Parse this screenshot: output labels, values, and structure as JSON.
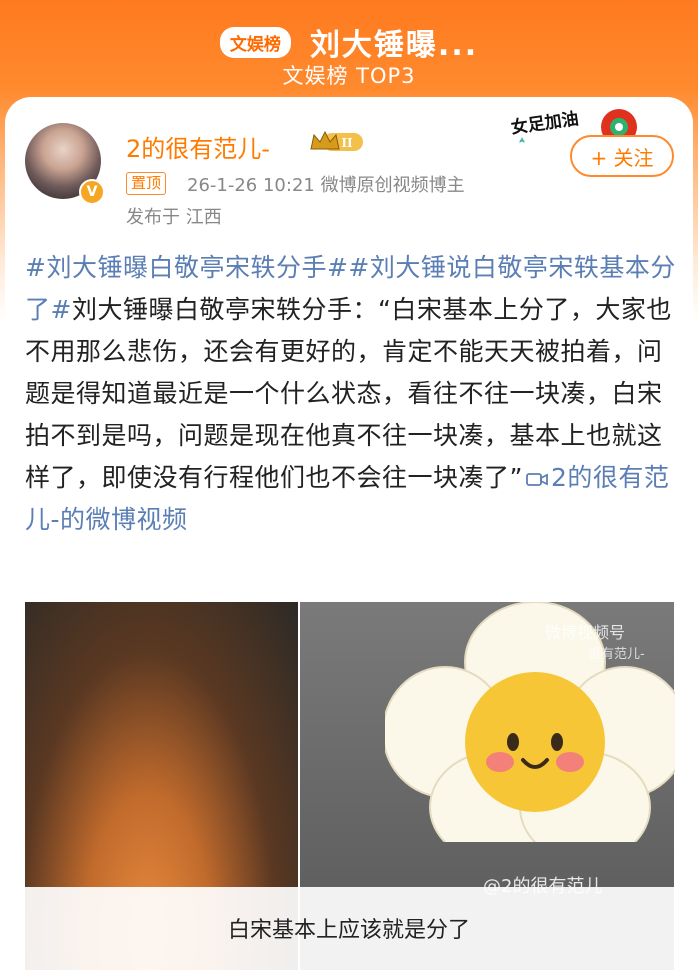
{
  "header": {
    "badge": "文娱榜",
    "title": "刘大锤曝...",
    "subtitle": "文娱榜 TOP3"
  },
  "post": {
    "author": "2的很有范儿-",
    "pinned": "置顶",
    "meta": "26-1-26 10:21  微博原创视频博主",
    "location": "发布于 江西",
    "follow": "+ 关注",
    "sticker_text": "女足加油",
    "tag1": "#刘大锤曝白敬亭宋轶分手#",
    "tag2": "#刘大锤说白敬亭宋轶基本分了#",
    "text1": "刘大锤曝白敬亭宋轶分手：“白宋基本上分了，大家也不用那么悲伤，还会有更好的，肯定不能天天被拍着，问题是得知道最近是一个什么状态，看往不往一块凑，白宋拍不到是吗，问题是现在他真不往一块凑，基本上也就这样了，即使没有行程他们也不会往一块凑了”",
    "video_link": "2的很有范儿-的微博视频"
  },
  "media": {
    "watermark": "微博视频号",
    "watermark_sub": "很有范儿-",
    "handle": "@2的很有范儿",
    "subtitle": "白宋基本上应该就是分了"
  }
}
